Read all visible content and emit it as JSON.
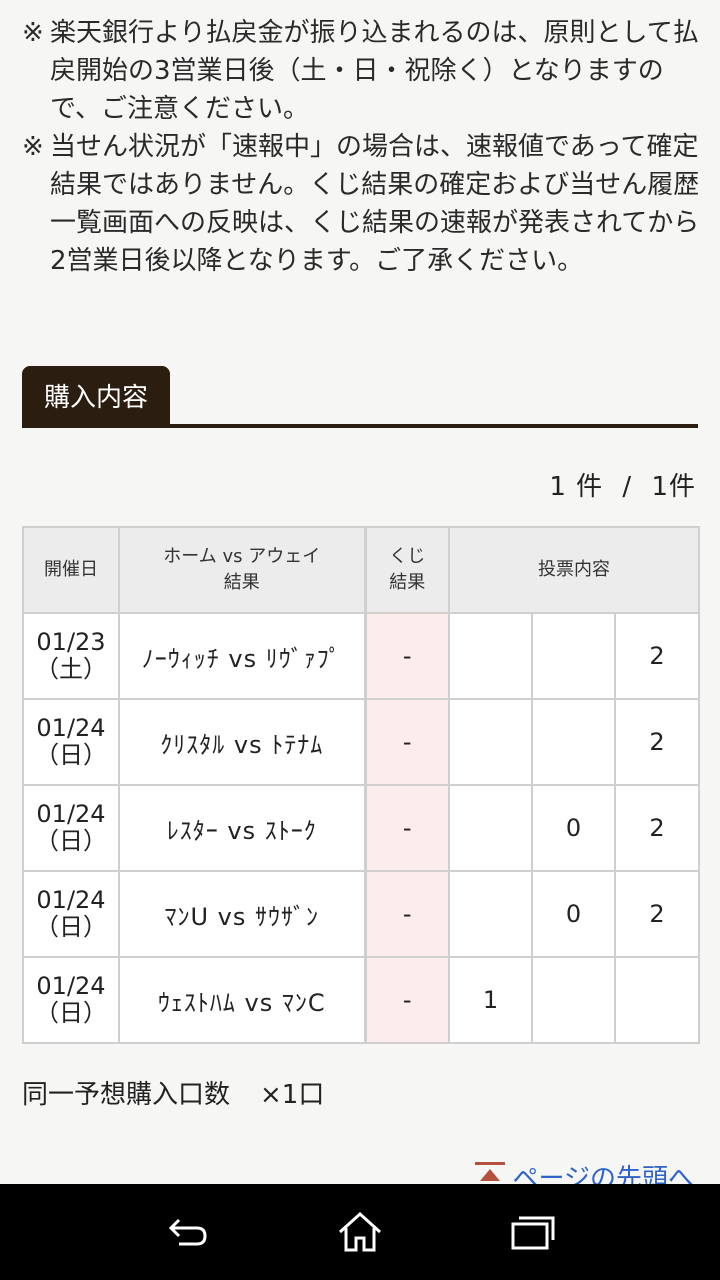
{
  "notes": [
    {
      "mark": "※",
      "text": "楽天銀行より払戻金が振り込まれるのは、原則として払戻開始の3営業日後（土・日・祝除く）となりますので、ご注意ください。"
    },
    {
      "mark": "※",
      "text": "当せん状況が「速報中」の場合は、速報値であって確定結果ではありません。くじ結果の確定および当せん履歴一覧画面への反映は、くじ結果の速報が発表されてから2営業日後以降となります。ご了承ください。"
    }
  ],
  "section": {
    "title": "購入内容"
  },
  "pagination": {
    "current": "1 件",
    "sep": "/",
    "total": "1件"
  },
  "table": {
    "headers": {
      "date": "開催日",
      "match_line1": "ホーム vs アウェイ",
      "match_line2": "結果",
      "kuji_line1": "くじ",
      "kuji_line2": "結果",
      "vote": "投票内容"
    },
    "rows": [
      {
        "date": "01/23",
        "day": "（土）",
        "match": "ﾉｰｳｨｯﾁ vs ﾘｳﾞｧﾌﾟ",
        "kuji": "-",
        "v1": "",
        "v0": "",
        "v2": "2"
      },
      {
        "date": "01/24",
        "day": "（日）",
        "match": "ｸﾘｽﾀﾙ vs ﾄﾃﾅﾑ",
        "kuji": "-",
        "v1": "",
        "v0": "",
        "v2": "2"
      },
      {
        "date": "01/24",
        "day": "（日）",
        "match": "ﾚｽﾀｰ vs ｽﾄｰｸ",
        "kuji": "-",
        "v1": "",
        "v0": "0",
        "v2": "2"
      },
      {
        "date": "01/24",
        "day": "（日）",
        "match": "ﾏﾝU vs ｻｳｻﾞﾝ",
        "kuji": "-",
        "v1": "",
        "v0": "0",
        "v2": "2"
      },
      {
        "date": "01/24",
        "day": "（日）",
        "match": "ｳｪｽﾄﾊﾑ vs ﾏﾝC",
        "kuji": "-",
        "v1": "1",
        "v0": "",
        "v2": ""
      }
    ]
  },
  "same_count": {
    "label": "同一予想購入口数",
    "value": "×1口"
  },
  "page_top": {
    "label": "ページの先頭へ"
  },
  "colors": {
    "accent": "#2b1d10",
    "link": "#2f63c8",
    "kuji_bg": "#fcecec"
  },
  "navbar": {
    "icons": [
      "back-icon",
      "home-icon",
      "recents-icon"
    ]
  }
}
